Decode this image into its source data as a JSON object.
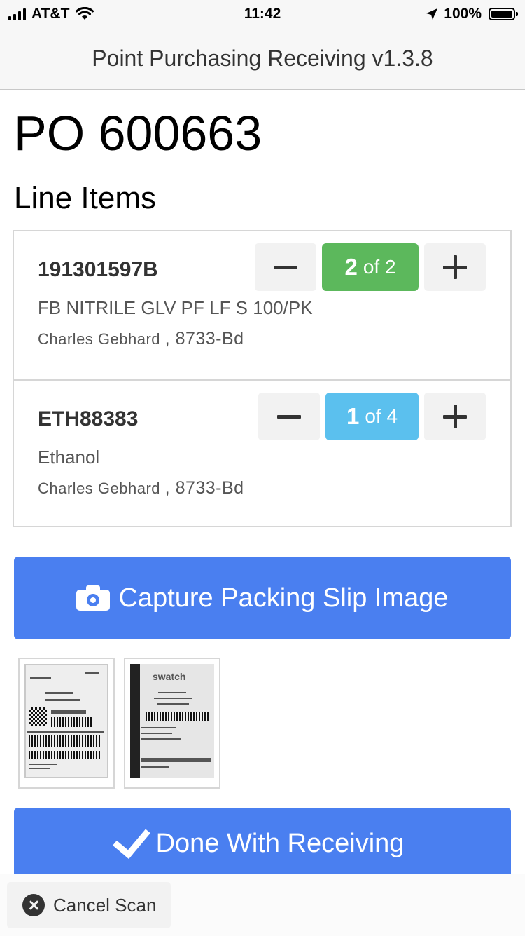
{
  "status_bar": {
    "carrier": "AT&T",
    "time": "11:42",
    "battery": "100%"
  },
  "header": {
    "title": "Point Purchasing Receiving v1.3.8"
  },
  "page": {
    "po_title": "PO 600663",
    "line_items_heading": "Line Items"
  },
  "line_items": [
    {
      "sku": "191301597B",
      "description": "FB NITRILE GLV PF LF S 100/PK",
      "requester": "Charles Gebhard",
      "location": ", 8733-Bd",
      "received": "2",
      "of_total": "of 2",
      "badge_color": "#5cb85c"
    },
    {
      "sku": "ETH88383",
      "description": "Ethanol",
      "requester": "Charles Gebhard",
      "location": ", 8733-Bd",
      "received": "1",
      "of_total": "of 4",
      "badge_color": "#5bc0ee"
    }
  ],
  "actions": {
    "capture_label": "Capture Packing Slip Image",
    "done_label": "Done With Receiving",
    "cancel_label": "Cancel Scan"
  },
  "thumbnails": [
    {
      "icon": "packing-slip-photo"
    },
    {
      "icon": "receipt-photo",
      "logo_text": "swatch"
    }
  ],
  "colors": {
    "primary": "#4a7ff0",
    "success": "#5cb85c",
    "info": "#5bc0ee"
  }
}
